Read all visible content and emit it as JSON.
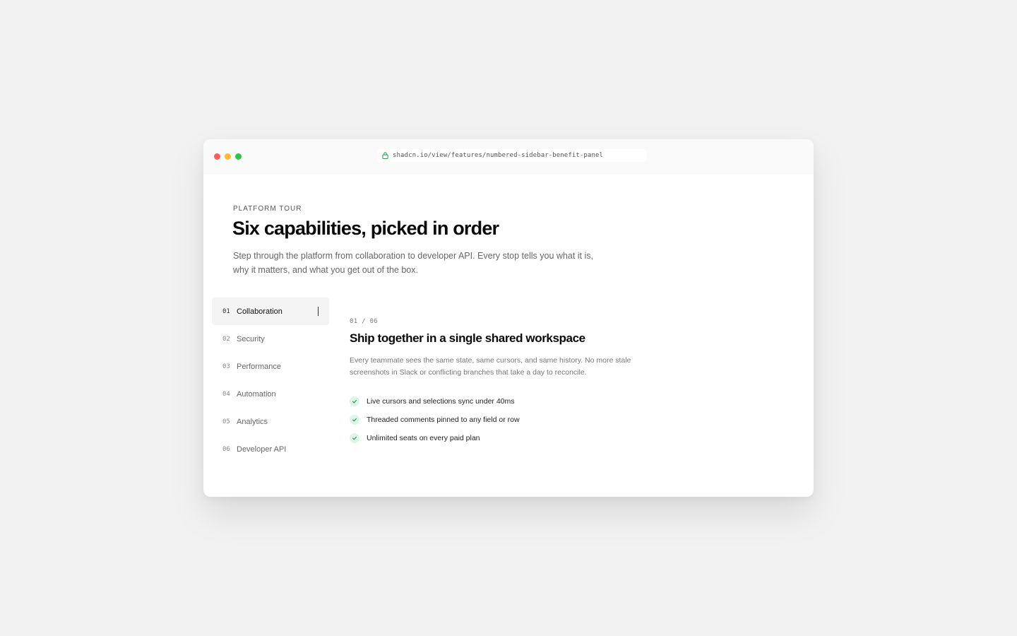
{
  "browser": {
    "url": "shadcn.io/view/features/numbered-sidebar-benefit-panel"
  },
  "header": {
    "eyebrow": "PLATFORM TOUR",
    "title": "Six capabilities, picked in order",
    "intro": "Step through the platform from collaboration to developer API. Every stop tells you what it is, why it matters, and what you get out of the box."
  },
  "sidebar": {
    "items": [
      {
        "num": "01",
        "label": "Collaboration",
        "active": true
      },
      {
        "num": "02",
        "label": "Security"
      },
      {
        "num": "03",
        "label": "Performance"
      },
      {
        "num": "04",
        "label": "Automation"
      },
      {
        "num": "05",
        "label": "Analytics"
      },
      {
        "num": "06",
        "label": "Developer API"
      }
    ]
  },
  "panel": {
    "counter": "01 / 06",
    "title": "Ship together in a single shared workspace",
    "description": "Every teammate sees the same state, same cursors, and same history. No more stale screenshots in Slack or conflicting branches that take a day to reconcile.",
    "benefits": [
      "Live cursors and selections sync under 40ms",
      "Threaded comments pinned to any field or row",
      "Unlimited seats on every paid plan"
    ]
  },
  "colors": {
    "background": "#f2f2f2",
    "window": "#ffffff",
    "check_bg": "#dcf5e6",
    "check_stroke": "#1f9d55",
    "lock": "#2e9d5a",
    "traffic_red": "#ff5f57",
    "traffic_yellow": "#febc2e",
    "traffic_green": "#28c840"
  },
  "icons": {
    "lock": "lock-icon",
    "check": "check-icon"
  }
}
